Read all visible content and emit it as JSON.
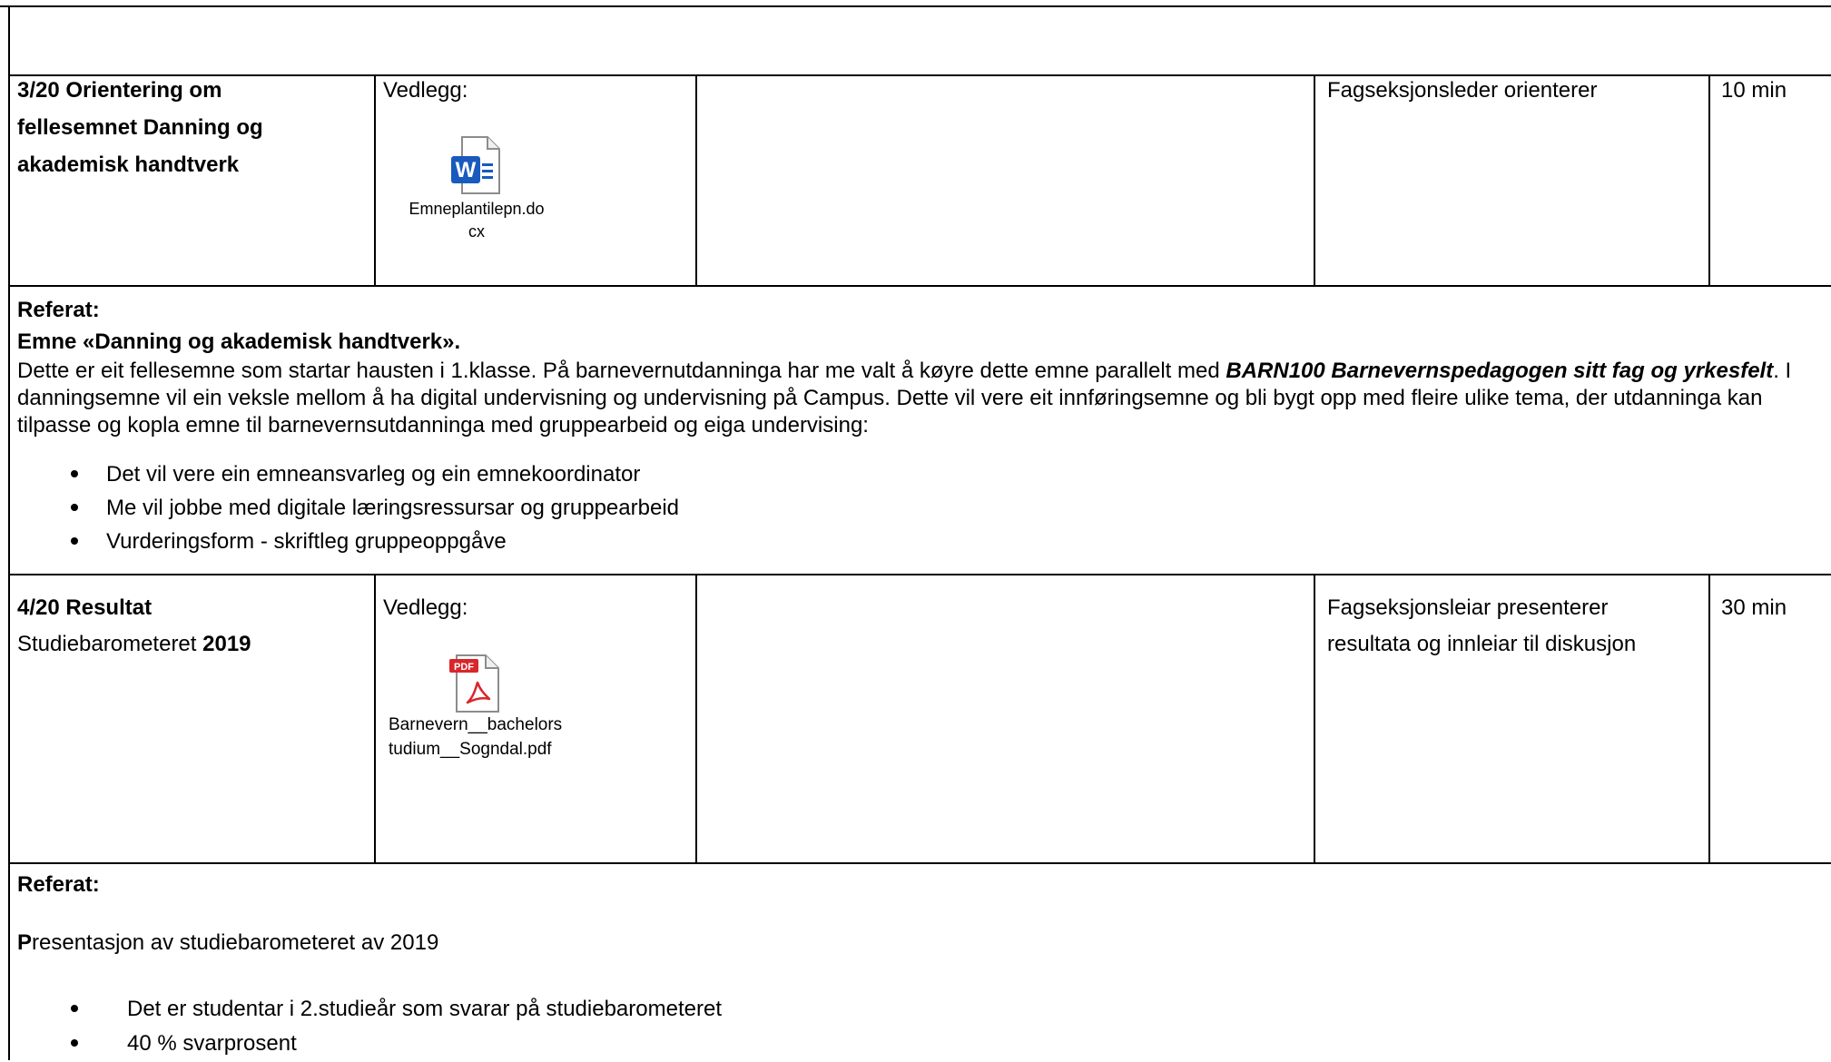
{
  "row3": {
    "number": "3/20",
    "title_lines": [
      "Orientering om",
      "fellesemnet Danning og",
      "akademisk handtverk"
    ],
    "vedlegg_label": "Vedlegg:",
    "attachment": {
      "icon": "word-doc-icon",
      "name_line1": "Emneplantilepn.do",
      "name_line2": "cx"
    },
    "responsible": "Fagseksjonsleder orienterer",
    "time": "10 min"
  },
  "referat3": {
    "label": "Referat:",
    "heading": "Emne «Danning og akademisk handtverk».",
    "para_part1": "Dette er eit fellesemne som startar hausten i 1.klasse. På barnevernutdanninga har me valt å køyre dette emne parallelt med ",
    "para_bold_italic": "BARN100 Barnevernspedagogen sitt fag og yrkesfelt",
    "para_part2": ". I danningsemne vil ein veksle mellom å ha digital undervisning og undervisning på Campus. Dette vil vere eit innføringsemne og bli bygt opp med fleire ulike tema, der utdanninga kan tilpasse og kopla emne til barnevernsutdanninga med gruppearbeid og eiga undervising:",
    "bullets": [
      "Det vil vere ein emneansvarleg og ein emnekoordinator",
      "Me vil jobbe med digitale læringsressursar og gruppearbeid",
      "Vurderingsform - skriftleg gruppeoppgåve"
    ]
  },
  "row4": {
    "number": "4/20",
    "title_bold": "Resultat",
    "subtitle_text": "Studiebarometeret ",
    "subtitle_year": "2019",
    "vedlegg_label": "Vedlegg:",
    "attachment": {
      "icon": "pdf-file-icon",
      "name_line1": "Barnevern__bachelors",
      "name_line2": "tudium__Sogndal.pdf"
    },
    "responsible_line1": "Fagseksjonsleiar presenterer",
    "responsible_line2": "resultata og innleiar til diskusjon",
    "time": "30 min"
  },
  "referat4": {
    "label": "Referat:",
    "intro_first": "P",
    "intro_rest": "resentasjon av studiebarometeret av 2019",
    "bullets": [
      "Det er studentar i 2.studieår som svarar på studiebarometeret",
      "40 % svarprosent"
    ]
  },
  "colors": {
    "border": "#000000",
    "word_blue": "#185abd",
    "pdf_red": "#d9262b"
  }
}
